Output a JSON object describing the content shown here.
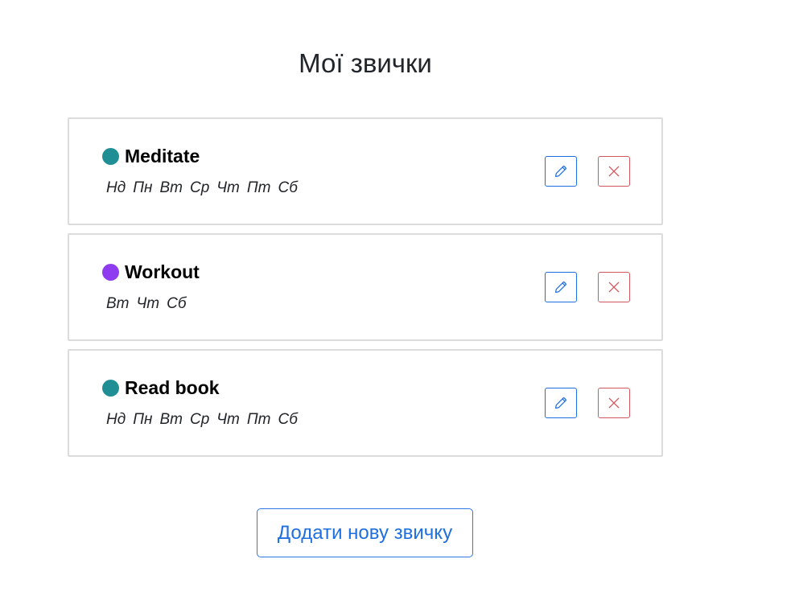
{
  "page": {
    "title": "Мої звички"
  },
  "habits": [
    {
      "name": "Meditate",
      "color": "#1f8f95",
      "days": [
        "Нд",
        "Пн",
        "Вт",
        "Ср",
        "Чт",
        "Пт",
        "Сб"
      ]
    },
    {
      "name": "Workout",
      "color": "#8f3cf0",
      "days": [
        "Вт",
        "Чт",
        "Сб"
      ]
    },
    {
      "name": "Read book",
      "color": "#1f8f95",
      "days": [
        "Нд",
        "Пн",
        "Вт",
        "Ср",
        "Чт",
        "Пт",
        "Сб"
      ]
    }
  ],
  "icons": {
    "edit": "pencil-icon",
    "delete": "close-icon"
  },
  "colors": {
    "primary": "#1f6fe0",
    "danger": "#d0575f",
    "card_border": "#dcdcdc"
  },
  "add_button": {
    "label": "Додати нову звичку"
  }
}
